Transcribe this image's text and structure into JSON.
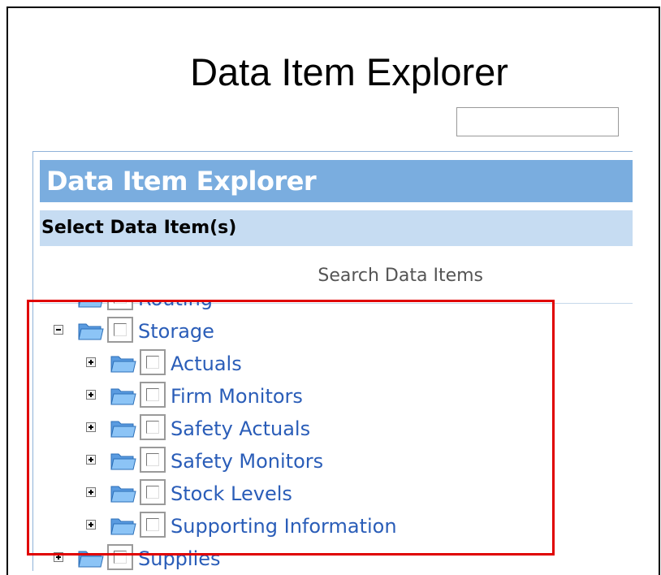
{
  "page": {
    "title": "Data Item Explorer"
  },
  "panel": {
    "title": "Data Item Explorer",
    "subtitle": "Select Data Item(s)",
    "search": {
      "label": "Search Data Items",
      "value": "",
      "placeholder": ""
    }
  },
  "tree": {
    "partial_top_label": "Routing",
    "root": {
      "label": "Storage",
      "expanded": true,
      "checked": false
    },
    "children": [
      {
        "label": "Actuals",
        "expanded": false,
        "checked": false
      },
      {
        "label": "Firm Monitors",
        "expanded": false,
        "checked": false
      },
      {
        "label": "Safety Actuals",
        "expanded": false,
        "checked": false
      },
      {
        "label": "Safety Monitors",
        "expanded": false,
        "checked": false
      },
      {
        "label": "Stock Levels",
        "expanded": false,
        "checked": false
      },
      {
        "label": "Supporting Information",
        "expanded": false,
        "checked": false
      }
    ],
    "partial_bottom_label": "Supplies"
  },
  "colors": {
    "header_bg": "#7aaddf",
    "subheader_bg": "#c6dcf2",
    "link_text": "#2a5db8",
    "highlight_border": "#e00000"
  },
  "icons": {
    "folder": "folder-open-icon",
    "expand": "plus-box-icon",
    "collapse": "minus-box-icon"
  }
}
